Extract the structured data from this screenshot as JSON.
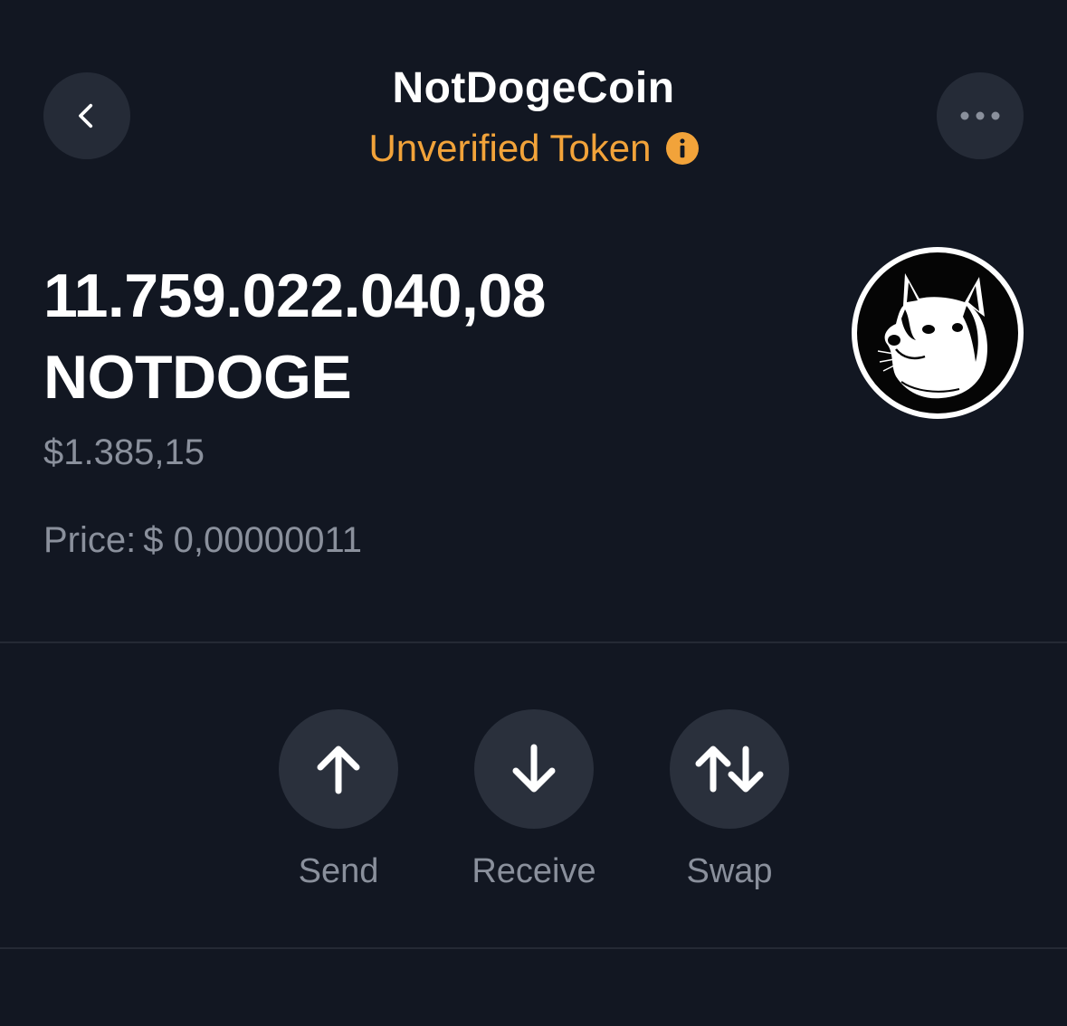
{
  "header": {
    "title": "NotDogeCoin",
    "subtitle": "Unverified Token",
    "back_icon": "chevron-left-icon",
    "more_icon": "ellipsis-icon",
    "info_icon": "info-icon"
  },
  "balance": {
    "amount": "11.759.022.040,08",
    "symbol": "NOTDOGE",
    "fiat_value": "$1.385,15"
  },
  "price": {
    "label": "Price:",
    "value": "$ 0,00000011"
  },
  "token_logo": {
    "icon": "doge-logo-icon"
  },
  "actions": [
    {
      "label": "Send",
      "icon": "arrow-up-icon"
    },
    {
      "label": "Receive",
      "icon": "arrow-down-icon"
    },
    {
      "label": "Swap",
      "icon": "swap-arrows-icon"
    }
  ],
  "colors": {
    "background": "#121722",
    "button": "#252b37",
    "accent_warning": "#f2a33a",
    "muted_text": "#8a909c"
  }
}
